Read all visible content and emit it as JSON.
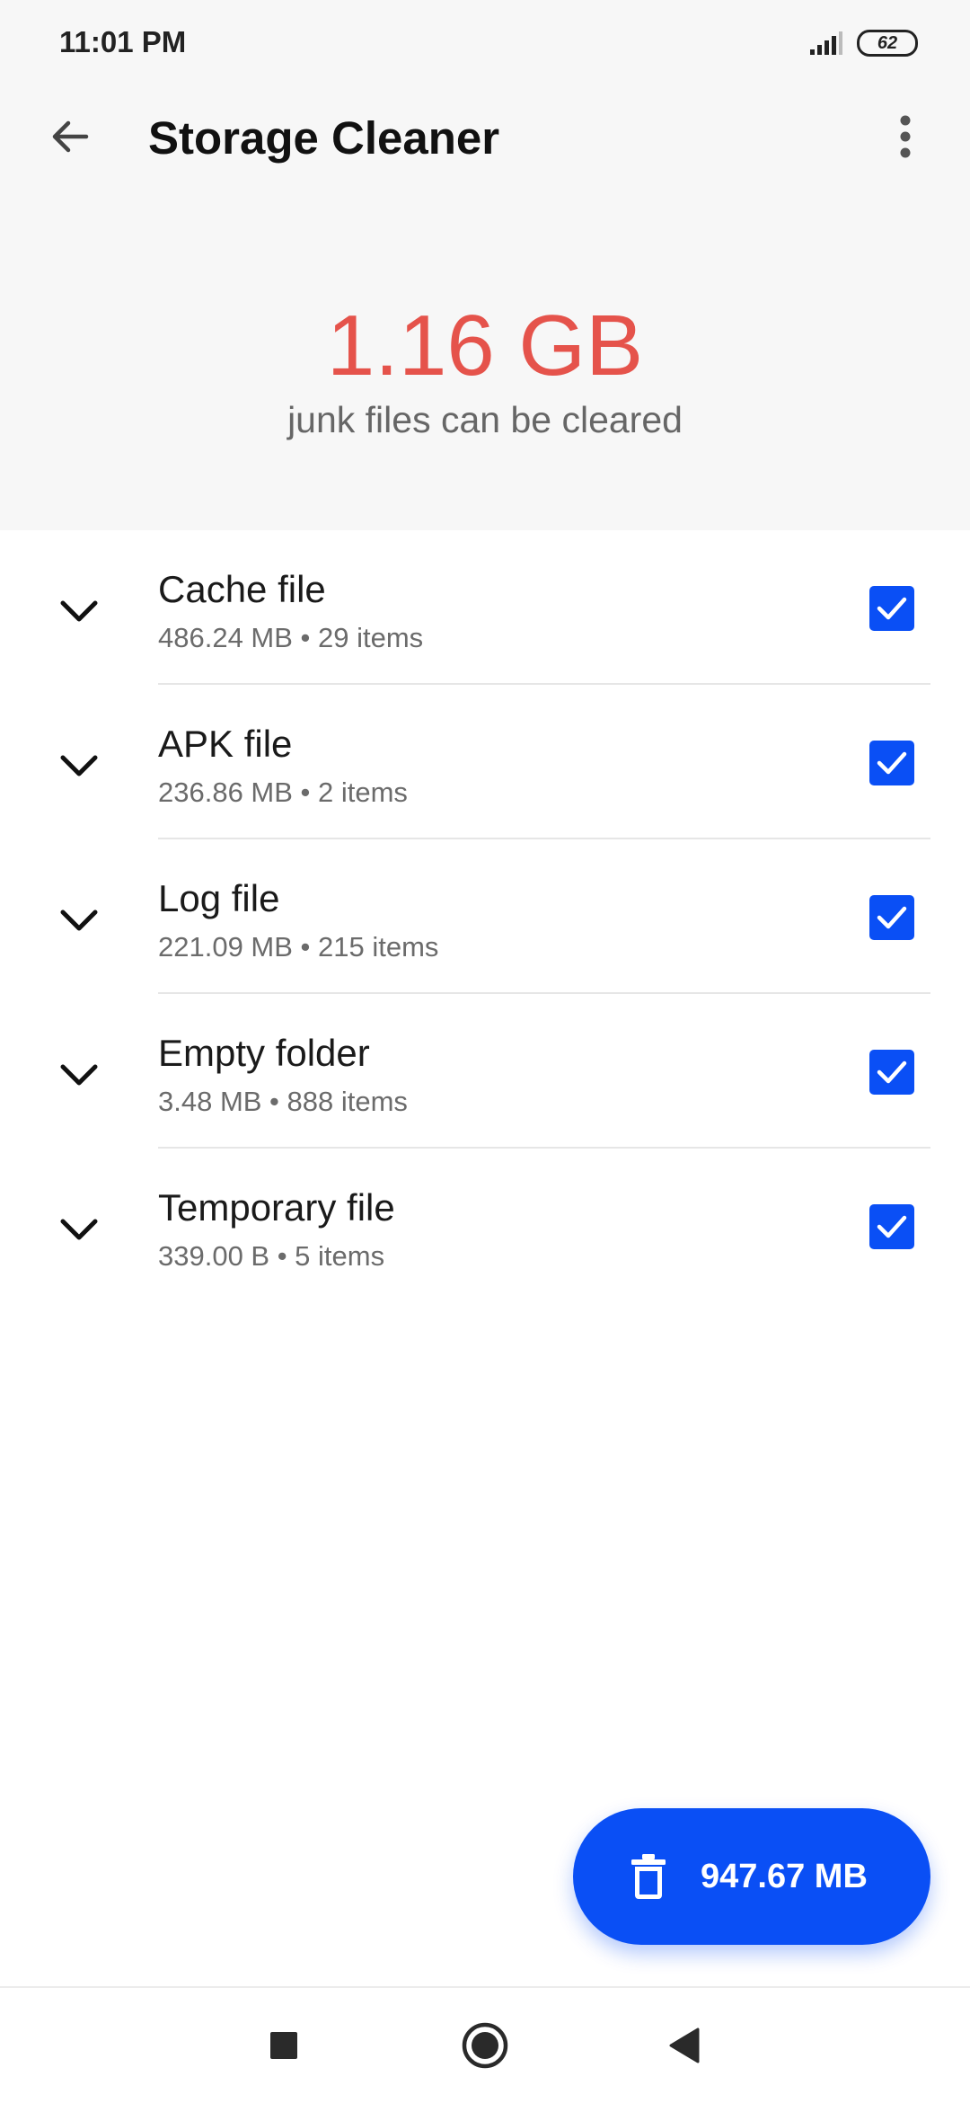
{
  "status_bar": {
    "time": "11:01 PM",
    "battery": "62"
  },
  "app_bar": {
    "title": "Storage Cleaner"
  },
  "summary": {
    "size": "1.16 GB",
    "caption": "junk files can be cleared"
  },
  "categories": [
    {
      "title": "Cache file",
      "details": "486.24 MB • 29 items",
      "checked": true
    },
    {
      "title": "APK file",
      "details": "236.86 MB • 2 items",
      "checked": true
    },
    {
      "title": "Log file",
      "details": "221.09 MB • 215 items",
      "checked": true
    },
    {
      "title": "Empty folder",
      "details": "3.48 MB • 888 items",
      "checked": true
    },
    {
      "title": "Temporary file",
      "details": "339.00 B • 5 items",
      "checked": true
    }
  ],
  "clean_button": {
    "label": "947.67 MB"
  },
  "colors": {
    "accent": "#0a4ff5",
    "summary_size": "#e5534b"
  },
  "icons": {
    "back": "back-arrow-icon",
    "more": "more-vert-icon",
    "expand": "chevron-down-icon",
    "checkbox": "checkbox-checked-icon",
    "clean": "trash-icon",
    "nav_recents": "square-icon",
    "nav_home": "circle-icon",
    "nav_back": "triangle-back-icon"
  }
}
